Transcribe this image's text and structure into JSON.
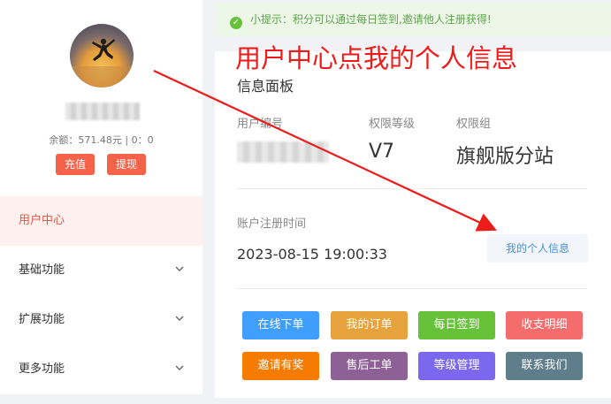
{
  "sidebar": {
    "balance": "余额：571.48元 | 0：0",
    "recharge_label": "充值",
    "withdraw_label": "提现",
    "menu": [
      {
        "label": "用户中心"
      },
      {
        "label": "基础功能"
      },
      {
        "label": "扩展功能"
      },
      {
        "label": "更多功能"
      }
    ]
  },
  "tip": {
    "text": "小提示：积分可以通过每日签到,邀请他人注册获得!"
  },
  "annotation": {
    "title": "用户中心点我的个人信息"
  },
  "panel": {
    "title": "信息面板",
    "fields": {
      "user_id_label": "用户编号",
      "level_label": "权限等级",
      "level_value": "V7",
      "group_label": "权限组",
      "group_value": "旗舰版分站"
    },
    "register_label": "账户注册时间",
    "register_time": "2023-08-15 19:00:33",
    "my_info_label": "我的个人信息",
    "actions": [
      {
        "label": "在线下单",
        "color": "#409eff"
      },
      {
        "label": "我的订单",
        "color": "#e6a23c"
      },
      {
        "label": "每日签到",
        "color": "#67c23a"
      },
      {
        "label": "收支明细",
        "color": "#f56c6c"
      },
      {
        "label": "邀请有奖",
        "color": "#f57c00"
      },
      {
        "label": "售后工单",
        "color": "#8e6196"
      },
      {
        "label": "等级管理",
        "color": "#7b68ee"
      },
      {
        "label": "联系我们",
        "color": "#607d8b"
      }
    ]
  },
  "colors": {
    "accent_red": "#f4624a",
    "annotation_red": "#ee1b1b",
    "tip_green": "#67c23a"
  }
}
